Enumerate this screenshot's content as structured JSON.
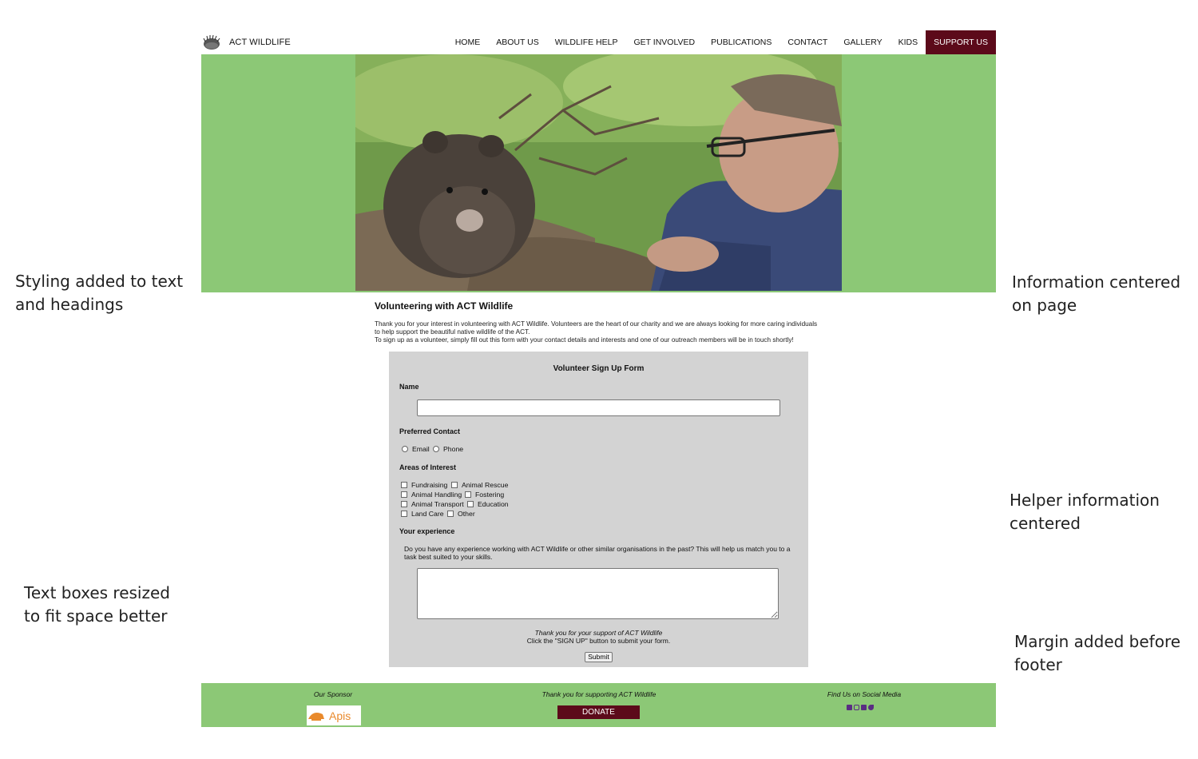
{
  "annotations": {
    "note1": "Styling added to text\nand headings",
    "note2": "Information centered\non page",
    "note3": "Helper information\ncentered",
    "note4": "Text boxes resized\nto fit space better",
    "note5": "Margin added before\nfooter"
  },
  "site": {
    "brand": "ACT WILDLIFE",
    "nav": [
      "HOME",
      "ABOUT US",
      "WILDLIFE HELP",
      "GET INVOLVED",
      "PUBLICATIONS",
      "CONTACT",
      "GALLERY",
      "KIDS",
      "SUPPORT US"
    ]
  },
  "intro": {
    "heading": "Volunteering with ACT Wildlife",
    "p1": "Thank you for your interest in volunteering with ACT Wildlife. Volunteers are the heart of our charity and we are always looking for more caring individuals to help support the beautiful native wildlife of the ACT.",
    "p2": "To sign up as a volunteer, simply fill out this form with your contact details and interests and one of our outreach members will be in touch shortly!"
  },
  "form": {
    "title": "Volunteer Sign Up Form",
    "name_label": "Name",
    "contact_label": "Preferred Contact",
    "contact_options": [
      "Email",
      "Phone"
    ],
    "interest_label": "Areas of Interest",
    "interests": [
      "Fundraising",
      "Animal Rescue",
      "Animal Handling",
      "Fostering",
      "Animal Transport",
      "Education",
      "Land Care",
      "Other"
    ],
    "experience_label": "Your experience",
    "experience_help": "Do you have any experience working with ACT Wildlife or other similar organisations in the past? This will help us match you to a task best suited to your skills.",
    "thanks_line1": "Thank you for your support of ACT Wildlife",
    "thanks_line2": "Click the \"SIGN UP\" button to submit your form.",
    "submit_label": "Submit"
  },
  "footer": {
    "sponsor_heading": "Our Sponsor",
    "sponsor_name": "Apis",
    "thanks_heading": "Thank you for supporting ACT Wildlife",
    "donate_label": "DONATE",
    "social_heading": "Find Us on Social Media",
    "social_icons": [
      "facebook-icon",
      "instagram-icon",
      "youtube-icon",
      "twitter-icon"
    ]
  },
  "colors": {
    "brand_green": "#8cc876",
    "accent_maroon": "#5c0a1a",
    "form_grey": "#d3d3d3"
  }
}
